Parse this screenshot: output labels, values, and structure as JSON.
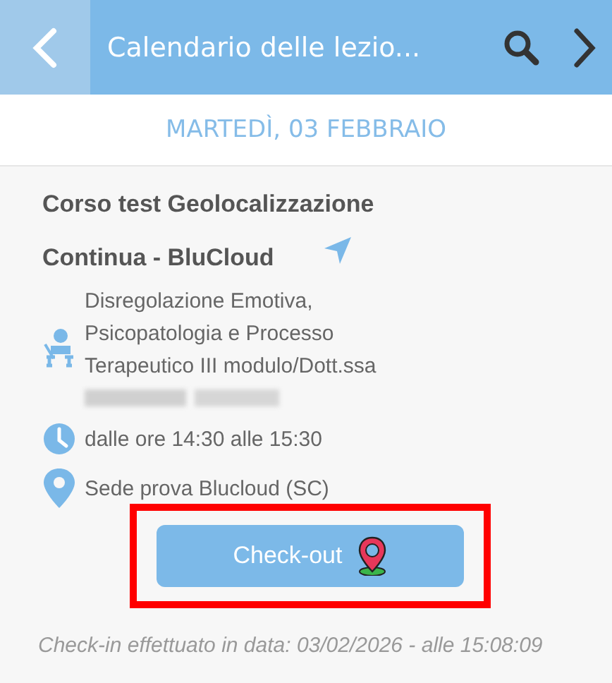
{
  "header": {
    "title": "Calendario delle lezio..."
  },
  "date": "MARTEDÌ, 03 FEBBRAIO",
  "event": {
    "title_lines": [
      "Corso test Geolocalizzazione",
      "Continua - BluCloud"
    ],
    "teacher_lines": [
      "Disregolazione Emotiva,",
      "Psicopatologia e Processo",
      "Terapeutico III modulo/Dott.ssa"
    ],
    "time": "dalle ore 14:30 alle 15:30",
    "place": "Sede prova Blucloud (SC)"
  },
  "button": {
    "label": "Check-out",
    "highlighted": true
  },
  "footer": "Check-in effettuato in data: 03/02/2026 - alle 15:08:09"
}
